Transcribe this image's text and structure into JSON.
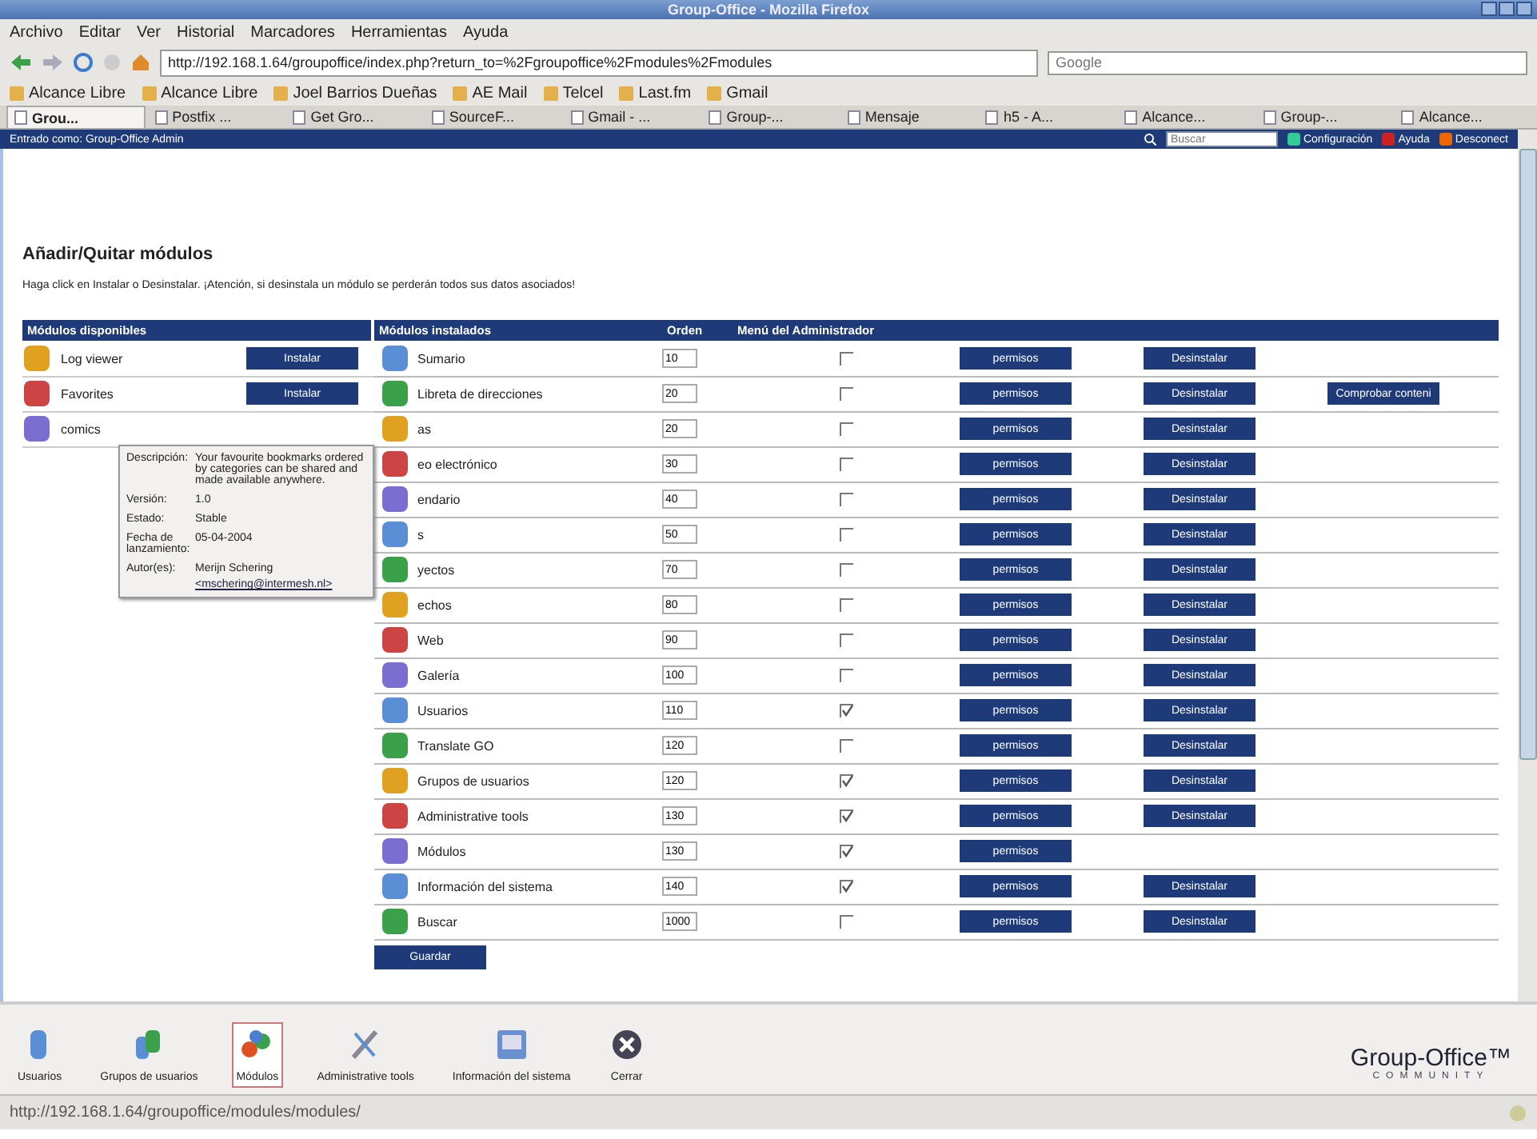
{
  "window": {
    "title": "Group-Office - Mozilla Firefox"
  },
  "menu": [
    "Archivo",
    "Editar",
    "Ver",
    "Historial",
    "Marcadores",
    "Herramientas",
    "Ayuda"
  ],
  "address_bar": {
    "value": "http://192.168.1.64/groupoffice/index.php?return_to=%2Fgroupoffice%2Fmodules%2Fmodules"
  },
  "search_engine": {
    "placeholder": "Google"
  },
  "bookmarks": [
    "Alcance Libre",
    "Alcance Libre",
    "Joel Barrios Dueñas",
    "AE Mail",
    "Telcel",
    "Last.fm",
    "Gmail"
  ],
  "tabs": [
    {
      "label": "Grou...",
      "selected": true
    },
    {
      "label": "Postfix ...",
      "selected": false
    },
    {
      "label": "Get Gro...",
      "selected": false
    },
    {
      "label": "SourceF...",
      "selected": false
    },
    {
      "label": "Gmail - ...",
      "selected": false
    },
    {
      "label": "Group-...",
      "selected": false
    },
    {
      "label": "Mensaje",
      "selected": false
    },
    {
      "label": "h5 - A...",
      "selected": false
    },
    {
      "label": "Alcance...",
      "selected": false
    },
    {
      "label": "Group-...",
      "selected": false
    },
    {
      "label": "Alcance...",
      "selected": false
    }
  ],
  "app_header": {
    "user": "Entrado como: Group-Office Admin",
    "search": {
      "placeholder": "Buscar"
    },
    "links": [
      "Configuración",
      "Ayuda",
      "Desconect"
    ]
  },
  "heading": "Añadir/Quitar módulos",
  "instructions": "Haga click en Instalar o Desinstalar. ¡Atención, si desinstala un módulo se perderán todos sus datos asociados!",
  "available": {
    "title": "Módulos disponibles",
    "rows": [
      {
        "name": "Log viewer",
        "button": "Instalar"
      },
      {
        "name": "Favorites",
        "button": "Instalar"
      },
      {
        "name": "comics"
      }
    ]
  },
  "installed": {
    "columns": [
      "Módulos instalados",
      "Orden",
      "Menú del Administrador"
    ],
    "rows": [
      {
        "name": "Sumario",
        "order": "10",
        "admin_menu": false,
        "buttons": [
          "permisos",
          "Desinstalar"
        ]
      },
      {
        "name": "Libreta de direcciones",
        "order": "20",
        "admin_menu": false,
        "buttons": [
          "permisos",
          "Desinstalar",
          "Comprobar conteni"
        ]
      },
      {
        "name": "as",
        "order": "20",
        "admin_menu": false,
        "buttons": [
          "permisos",
          "Desinstalar"
        ]
      },
      {
        "name": "eo electrónico",
        "order": "30",
        "admin_menu": false,
        "buttons": [
          "permisos",
          "Desinstalar"
        ]
      },
      {
        "name": "endario",
        "order": "40",
        "admin_menu": false,
        "buttons": [
          "permisos",
          "Desinstalar"
        ]
      },
      {
        "name": "s",
        "order": "50",
        "admin_menu": false,
        "buttons": [
          "permisos",
          "Desinstalar"
        ]
      },
      {
        "name": "yectos",
        "order": "70",
        "admin_menu": false,
        "buttons": [
          "permisos",
          "Desinstalar"
        ]
      },
      {
        "name": "echos",
        "order": "80",
        "admin_menu": false,
        "buttons": [
          "permisos",
          "Desinstalar"
        ]
      },
      {
        "name": "Web",
        "order": "90",
        "admin_menu": false,
        "buttons": [
          "permisos",
          "Desinstalar"
        ]
      },
      {
        "name": "Galería",
        "order": "100",
        "admin_menu": false,
        "buttons": [
          "permisos",
          "Desinstalar"
        ]
      },
      {
        "name": "Usuarios",
        "order": "110",
        "admin_menu": true,
        "buttons": [
          "permisos",
          "Desinstalar"
        ]
      },
      {
        "name": "Translate GO",
        "order": "120",
        "admin_menu": false,
        "buttons": [
          "permisos",
          "Desinstalar"
        ]
      },
      {
        "name": "Grupos de usuarios",
        "order": "120",
        "admin_menu": true,
        "buttons": [
          "permisos",
          "Desinstalar"
        ]
      },
      {
        "name": "Administrative tools",
        "order": "130",
        "admin_menu": true,
        "buttons": [
          "permisos",
          "Desinstalar"
        ]
      },
      {
        "name": "Módulos",
        "order": "130",
        "admin_menu": true,
        "buttons": [
          "permisos"
        ]
      },
      {
        "name": "Información del sistema",
        "order": "140",
        "admin_menu": true,
        "buttons": [
          "permisos",
          "Desinstalar"
        ]
      },
      {
        "name": "Buscar",
        "order": "1000",
        "admin_menu": false,
        "buttons": [
          "permisos",
          "Desinstalar"
        ]
      }
    ]
  },
  "save_button": "Guardar",
  "tooltip": {
    "rows": [
      {
        "label": "Descripción:",
        "value": "Your favourite bookmarks ordered by categories can be shared and made available anywhere."
      },
      {
        "label": "Versión:",
        "value": "1.0"
      },
      {
        "label": "Estado:",
        "value": "Stable"
      },
      {
        "label": "Fecha de lanzamiento:",
        "value": "05-04-2004"
      },
      {
        "label": "Autor(es):",
        "value": "Merijn Schering",
        "link": "<mschering@intermesh.nl>"
      }
    ]
  },
  "dock": [
    {
      "label": "Usuarios",
      "selected": false
    },
    {
      "label": "Grupos de usuarios",
      "selected": false
    },
    {
      "label": "Módulos",
      "selected": true
    },
    {
      "label": "Administrative tools",
      "selected": false
    },
    {
      "label": "Información del sistema",
      "selected": false
    },
    {
      "label": "Cerrar",
      "selected": false
    }
  ],
  "logo": {
    "name": "Group-Office™",
    "tagline": "COMMUNITY"
  },
  "status_bar": "http://192.168.1.64/groupoffice/modules/modules/"
}
